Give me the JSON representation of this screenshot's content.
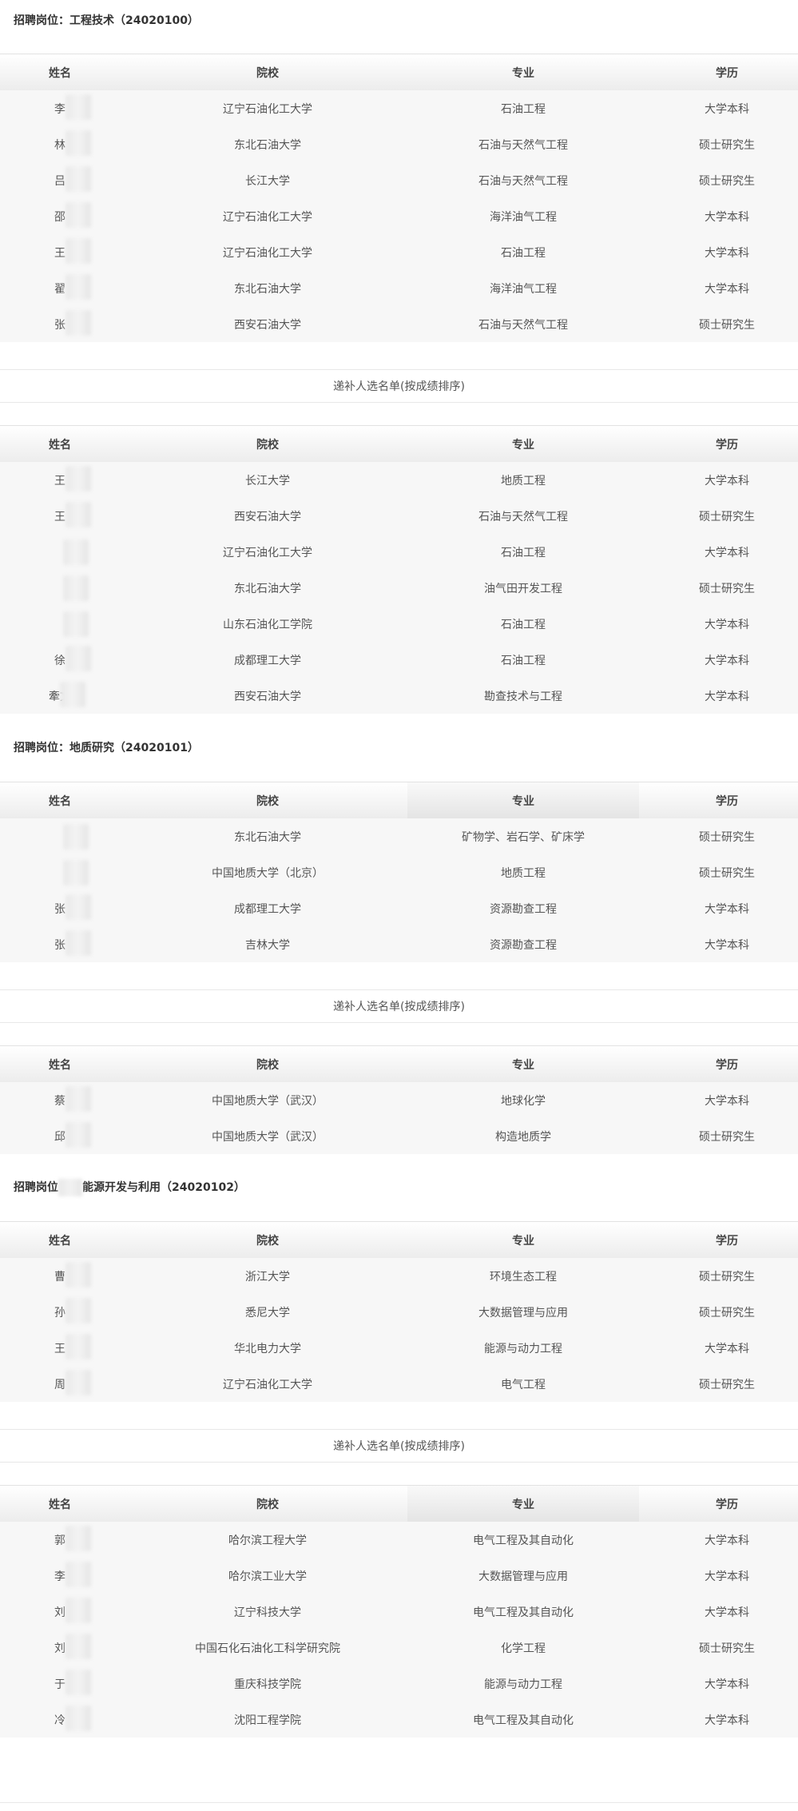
{
  "sections": [
    {
      "title": "招聘岗位：工程技术（24020100）",
      "headers": [
        "姓名",
        "院校",
        "专业",
        "学历"
      ],
      "main_rows": [
        [
          "李",
          "辽宁石油化工大学",
          "石油工程",
          "大学本科"
        ],
        [
          "林",
          "东北石油大学",
          "石油与天然气工程",
          "硕士研究生"
        ],
        [
          "吕",
          "长江大学",
          "石油与天然气工程",
          "硕士研究生"
        ],
        [
          "邵",
          "辽宁石油化工大学",
          "海洋油气工程",
          "大学本科"
        ],
        [
          "王",
          "辽宁石油化工大学",
          "石油工程",
          "大学本科"
        ],
        [
          "翟",
          "东北石油大学",
          "海洋油气工程",
          "大学本科"
        ],
        [
          "张",
          "西安石油大学",
          "石油与天然气工程",
          "硕士研究生"
        ]
      ],
      "backup_title": "递补人选名单(按成绩排序)",
      "backup_rows": [
        [
          "王",
          "长江大学",
          "地质工程",
          "大学本科"
        ],
        [
          "王",
          "西安石油大学",
          "石油与天然气工程",
          "硕士研究生"
        ],
        [
          "",
          "辽宁石油化工大学",
          "石油工程",
          "大学本科"
        ],
        [
          "",
          "东北石油大学",
          "油气田开发工程",
          "硕士研究生"
        ],
        [
          "",
          "山东石油化工学院",
          "石油工程",
          "大学本科"
        ],
        [
          "徐",
          "成都理工大学",
          "石油工程",
          "大学本科"
        ],
        [
          "牽文",
          "西安石油大学",
          "勘查技术与工程",
          "大学本科"
        ]
      ]
    },
    {
      "title": "招聘岗位：地质研究（24020101）",
      "headers": [
        "姓名",
        "院校",
        "专业",
        "学历"
      ],
      "main_rows": [
        [
          "",
          "东北石油大学",
          "矿物学、岩石学、矿床学",
          "硕士研究生"
        ],
        [
          "",
          "中国地质大学（北京）",
          "地质工程",
          "硕士研究生"
        ],
        [
          "张",
          "成都理工大学",
          "资源勘查工程",
          "大学本科"
        ],
        [
          "张",
          "吉林大学",
          "资源勘查工程",
          "大学本科"
        ]
      ],
      "backup_title": "递补人选名单(按成绩排序)",
      "backup_rows": [
        [
          "蔡",
          "中国地质大学（武汉）",
          "地球化学",
          "大学本科"
        ],
        [
          "邱",
          "中国地质大学（武汉）",
          "构造地质学",
          "硕士研究生"
        ]
      ]
    },
    {
      "title_prefix": "招聘岗位",
      "title_suffix": "能源开发与利用（24020102）",
      "headers": [
        "姓名",
        "院校",
        "专业",
        "学历"
      ],
      "main_rows": [
        [
          "曹",
          "浙江大学",
          "环境生态工程",
          "硕士研究生"
        ],
        [
          "孙",
          "悉尼大学",
          "大数据管理与应用",
          "硕士研究生"
        ],
        [
          "王",
          "华北电力大学",
          "能源与动力工程",
          "大学本科"
        ],
        [
          "周",
          "辽宁石油化工大学",
          "电气工程",
          "硕士研究生"
        ]
      ],
      "backup_title": "递补人选名单(按成绩排序)",
      "backup_rows": [
        [
          "郭",
          "哈尔滨工程大学",
          "电气工程及其自动化",
          "大学本科"
        ],
        [
          "李",
          "哈尔滨工业大学",
          "大数据管理与应用",
          "大学本科"
        ],
        [
          "刘",
          "辽宁科技大学",
          "电气工程及其自动化",
          "大学本科"
        ],
        [
          "刘",
          "中国石化石油化工科学研究院",
          "化学工程",
          "硕士研究生"
        ],
        [
          "于",
          "重庆科技学院",
          "能源与动力工程",
          "大学本科"
        ],
        [
          "冷",
          "沈阳工程学院",
          "电气工程及其自动化",
          "大学本科"
        ]
      ]
    }
  ]
}
